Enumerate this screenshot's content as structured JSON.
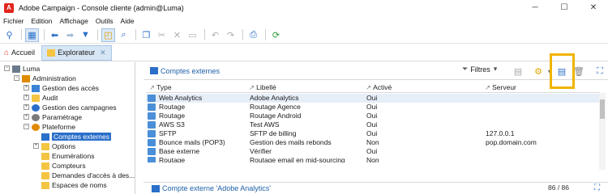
{
  "window": {
    "title": "Adobe Campaign - Console cliente (admin@Luma)",
    "logo": "A"
  },
  "menu": [
    "Fichier",
    "Edition",
    "Affichage",
    "Outils",
    "Aide"
  ],
  "tabs": {
    "home": "Accueil",
    "explorer": "Explorateur"
  },
  "tree": {
    "root": "Luma",
    "administration": "Administration",
    "items": [
      "Gestion des accès",
      "Audit",
      "Gestion des campagnes",
      "Paramétrage",
      "Plateforme",
      "Comptes externes",
      "Options",
      "Enumérations",
      "Compteurs",
      "Demandes d'accès à des...",
      "Espaces de noms"
    ]
  },
  "panel": {
    "title": "Comptes externes",
    "filters_label": "Filtres",
    "detail_title": "Compte externe 'Adobe Analytics'",
    "count": "86 / 86"
  },
  "table": {
    "columns": [
      "Type",
      "Libellé",
      "Activé",
      "Serveur"
    ],
    "rows": [
      {
        "type": "Web Analytics",
        "label": "Adobe Analytics",
        "enabled": "Oui",
        "server": ""
      },
      {
        "type": "Routage",
        "label": "Routage Agence",
        "enabled": "Oui",
        "server": ""
      },
      {
        "type": "Routage",
        "label": "Routage Android",
        "enabled": "Oui",
        "server": ""
      },
      {
        "type": "AWS S3",
        "label": "Test AWS",
        "enabled": "Oui",
        "server": ""
      },
      {
        "type": "SFTP",
        "label": "SFTP de billing",
        "enabled": "Oui",
        "server": "127.0.0.1"
      },
      {
        "type": "Bounce mails (POP3)",
        "label": "Gestion des mails rebonds",
        "enabled": "Non",
        "server": "pop.domain.com"
      },
      {
        "type": "Base externe",
        "label": "Vérifier",
        "enabled": "Oui",
        "server": ""
      },
      {
        "type": "Routage",
        "label": "Routage email en mid-sourcing",
        "enabled": "Non",
        "server": ""
      }
    ]
  },
  "colors": {
    "accent": "#2a6fc9",
    "highlight": "#f0b400",
    "brand": "#e1251b"
  }
}
